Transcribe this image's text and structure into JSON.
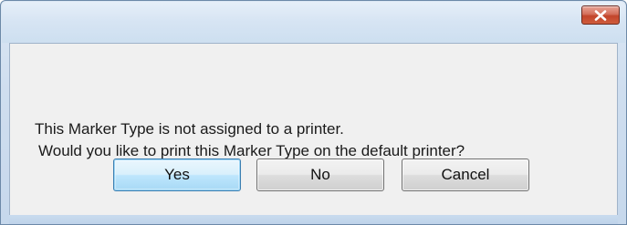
{
  "dialog": {
    "title": "",
    "close_icon": "close-x-icon",
    "message_line1": "This Marker Type is not assigned to a printer.",
    "message_line2": "Would you like to print this Marker Type on the default printer?"
  },
  "buttons": {
    "yes_label": "Yes",
    "no_label": "No",
    "cancel_label": "Cancel"
  },
  "colors": {
    "close_button": "#c2452b",
    "default_button_border": "#3c7fb1",
    "client_background": "#f0f0f0"
  }
}
